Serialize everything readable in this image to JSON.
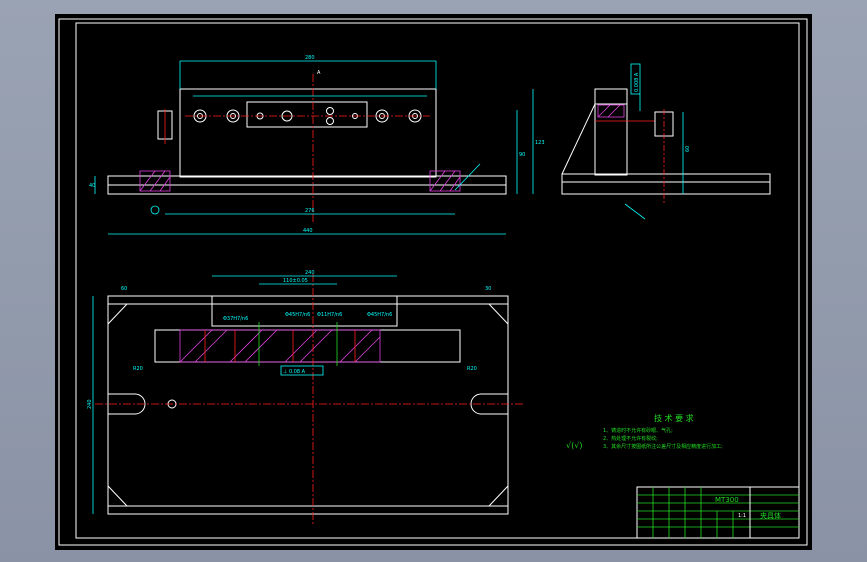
{
  "drawing": {
    "tech_title": "技 术 要 求",
    "notes": [
      "1、铸造时不允许有砂眼、气孔;",
      "2、热处理不允许有裂纹;",
      "3、其余尺寸按图纸所注公差尺寸及相应精度进行加工;"
    ],
    "roughness_symbol": "√(√)",
    "title_block": {
      "drawing_no": "MT300",
      "part_name": "夹具体",
      "scale": "1:1"
    },
    "dims": {
      "top_width": "280",
      "left_height": "40",
      "full_width": "440",
      "span_276": "276",
      "right_h1": "90",
      "right_h2": "123",
      "plan_top": "240",
      "plan_tol": "110±0.05",
      "plan_h": "240",
      "plan_w1": "60",
      "plan_w2": "30",
      "plan_fit1": "Φ37H7/n6",
      "plan_fit2": "Φ45H7/n6",
      "plan_fit3": "Φ11H7/n6",
      "plan_fit4": "Φ45H7/n6",
      "tol_box": "⊥ 0.08 A",
      "r20a": "R20",
      "r20b": "R20",
      "side_tol": "0.008 A",
      "side_dim": "60",
      "section": "A"
    }
  }
}
